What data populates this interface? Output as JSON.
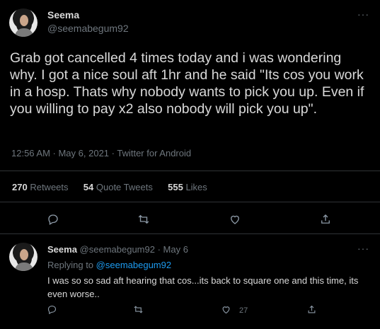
{
  "main_tweet": {
    "author_name": "Seema",
    "author_handle": "@seemabegum92",
    "more_label": "···",
    "text": "Grab got cancelled 4 times today and i was wondering why. I got a nice soul aft 1hr and he said \"Its cos you work in a hosp. Thats why nobody wants to pick you up. Even if you willing to pay x2 also nobody will pick you up\".",
    "timestamp": "12:56 AM · May 6, 2021 · Twitter for Android",
    "stats": {
      "retweets_count": "270",
      "retweets_label": "Retweets",
      "quotes_count": "54",
      "quotes_label": "Quote Tweets",
      "likes_count": "555",
      "likes_label": "Likes"
    },
    "actions": [
      "reply-icon",
      "retweet-icon",
      "like-icon",
      "share-icon"
    ]
  },
  "reply_tweet": {
    "author_name": "Seema",
    "author_handle_date": "@seemabegum92 · May 6",
    "more_label": "···",
    "replying_prefix": "Replying to",
    "replying_handle": "@seemabegum92",
    "text": "I was so so sad aft hearing that cos...its back to square one and this time, its even worse..",
    "like_count": "27",
    "actions": [
      "reply-icon",
      "retweet-icon",
      "like-icon",
      "share-icon"
    ]
  },
  "colors": {
    "background": "#000000",
    "text": "#d9d9d9",
    "muted": "#6e767d",
    "link": "#1d9bf0",
    "divider": "#2f3336"
  }
}
